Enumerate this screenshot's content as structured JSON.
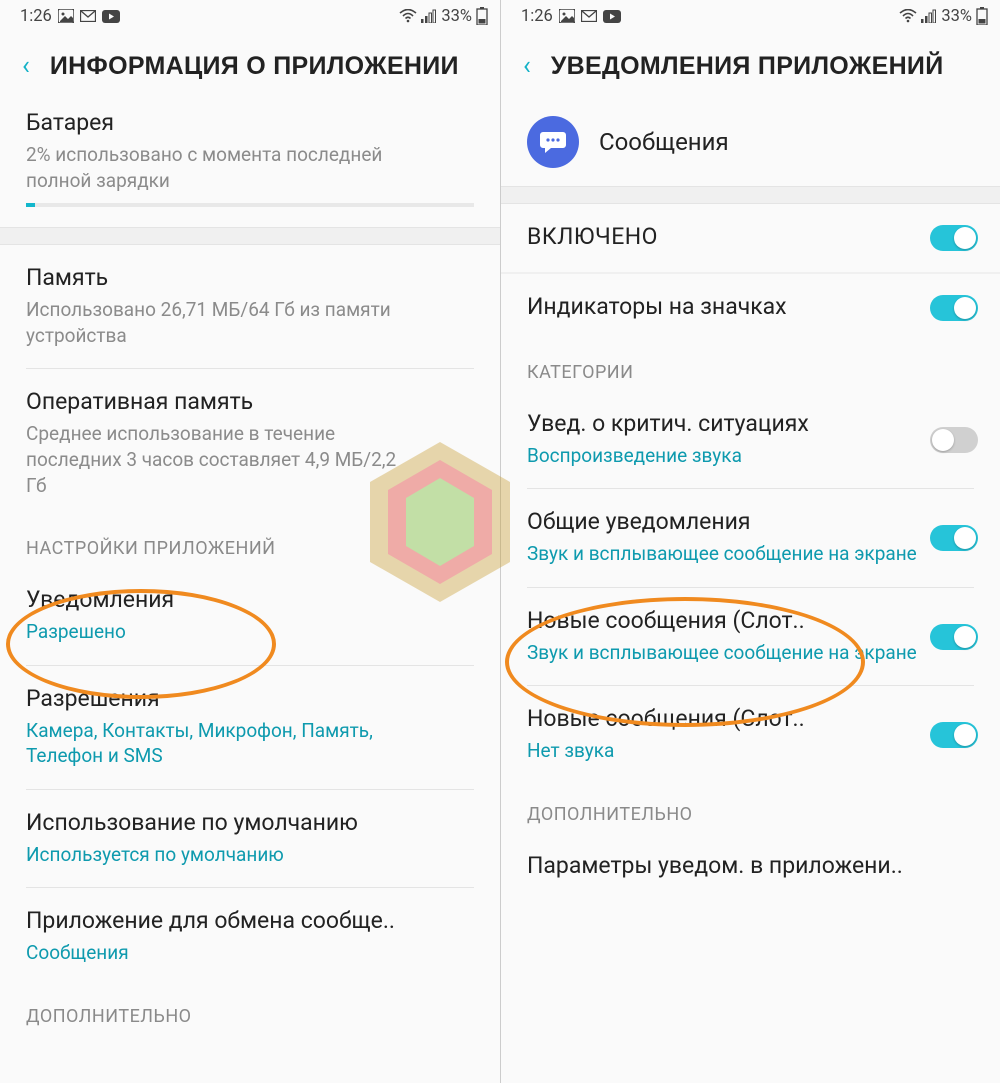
{
  "status": {
    "time": "1:26",
    "battery_pct": "33%"
  },
  "left": {
    "title": "ИНФОРМАЦИЯ О ПРИЛОЖЕНИИ",
    "battery": {
      "title": "Батарея",
      "sub": "2% использовано с момента последней полной зарядки"
    },
    "memory": {
      "title": "Память",
      "sub": "Использовано 26,71 МБ/64 Гб из памяти устройства"
    },
    "ram": {
      "title": "Оперативная память",
      "sub": "Среднее использование в течение последних 3 часов составляет 4,9 МБ/2,2 Гб"
    },
    "section_app": "НАСТРОЙКИ ПРИЛОЖЕНИЙ",
    "notifications": {
      "title": "Уведомления",
      "sub": "Разрешено"
    },
    "permissions": {
      "title": "Разрешения",
      "sub": "Камера, Контакты, Микрофон, Память, Телефон и SMS"
    },
    "default_use": {
      "title": "Использование по умолчанию",
      "sub": "Используется по умолчанию"
    },
    "exchange_app": {
      "title": "Приложение для обмена сообще..",
      "sub": "Сообщения"
    },
    "section_more": "ДОПОЛНИТЕЛЬНО"
  },
  "right": {
    "title": "УВЕДОМЛЕНИЯ ПРИЛОЖЕНИЙ",
    "app_name": "Сообщения",
    "enabled": "ВКЛЮЧЕНО",
    "badges": "Индикаторы на значках",
    "section_categories": "КАТЕГОРИИ",
    "crit": {
      "title": "Увед. о критич. ситуациях",
      "sub": "Воспроизведение звука"
    },
    "general": {
      "title": "Общие уведомления",
      "sub": "Звук и всплывающее сообщение на экране"
    },
    "slot1": {
      "title": "Новые сообщения (Слот..",
      "sub": "Звук и всплывающее сообщение на экране"
    },
    "slot2": {
      "title": "Новые сообщения (Слот..",
      "sub": "Нет звука"
    },
    "section_more": "ДОПОЛНИТЕЛЬНО",
    "params": "Параметры уведом. в приложени.."
  }
}
